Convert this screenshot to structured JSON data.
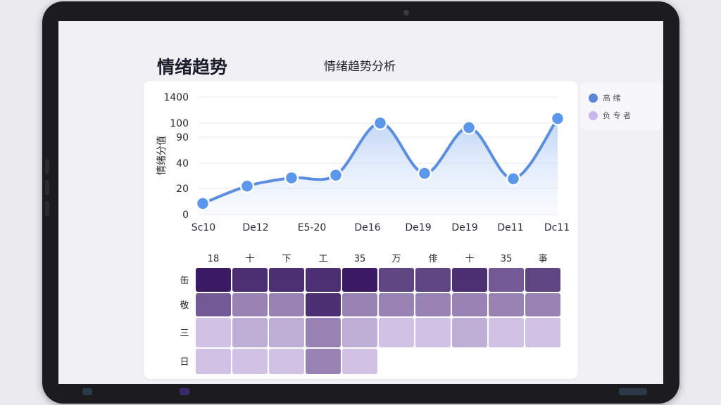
{
  "page": {
    "title": "情绪趋势",
    "subtitle": "情绪趋势分析"
  },
  "legend": {
    "items": [
      {
        "label": "高 绪",
        "color": "#5b85d8"
      },
      {
        "label": "负 专 者",
        "color": "#c9b6ec"
      }
    ]
  },
  "chart_data": [
    {
      "type": "area",
      "ylabel": "情绪分值",
      "y_ticks": [
        "1400",
        "100",
        "90",
        "40",
        "20",
        "0"
      ],
      "x_ticks": [
        "Sc10",
        "De12",
        "E5-20",
        "De16",
        "De19",
        "De19",
        "De11",
        "Dc11"
      ],
      "series": [
        {
          "points": [
            {
              "x": 0,
              "y": 12
            },
            {
              "x": 1,
              "y": 31
            },
            {
              "x": 2,
              "y": 40
            },
            {
              "x": 3,
              "y": 43
            },
            {
              "x": 4,
              "y": 100
            },
            {
              "x": 5,
              "y": 45
            },
            {
              "x": 6,
              "y": 95
            },
            {
              "x": 7,
              "y": 39
            },
            {
              "x": 8,
              "y": 105
            }
          ]
        }
      ],
      "line_color": "#5b8de0",
      "fill_color": "#cfe0fb",
      "grid": true
    },
    {
      "type": "heatmap",
      "col_labels": [
        "18",
        "十",
        "下",
        "工",
        "35",
        "万",
        "俳",
        "十",
        "35",
        "亊"
      ],
      "row_labels": [
        "缶",
        "敬",
        "三",
        "日"
      ],
      "values": [
        [
          10,
          9,
          9,
          9,
          10,
          8,
          8,
          9,
          7,
          8
        ],
        [
          7,
          5,
          5,
          9,
          5,
          5,
          5,
          5,
          5,
          5
        ],
        [
          2,
          3,
          3,
          5,
          3,
          2,
          2,
          3,
          2,
          2
        ],
        [
          2,
          2,
          2,
          5,
          2,
          null,
          null,
          null,
          null,
          null
        ]
      ],
      "range": [
        1,
        10
      ],
      "color_low": "#e4d7f5",
      "color_high": "#3a1b63"
    }
  ]
}
